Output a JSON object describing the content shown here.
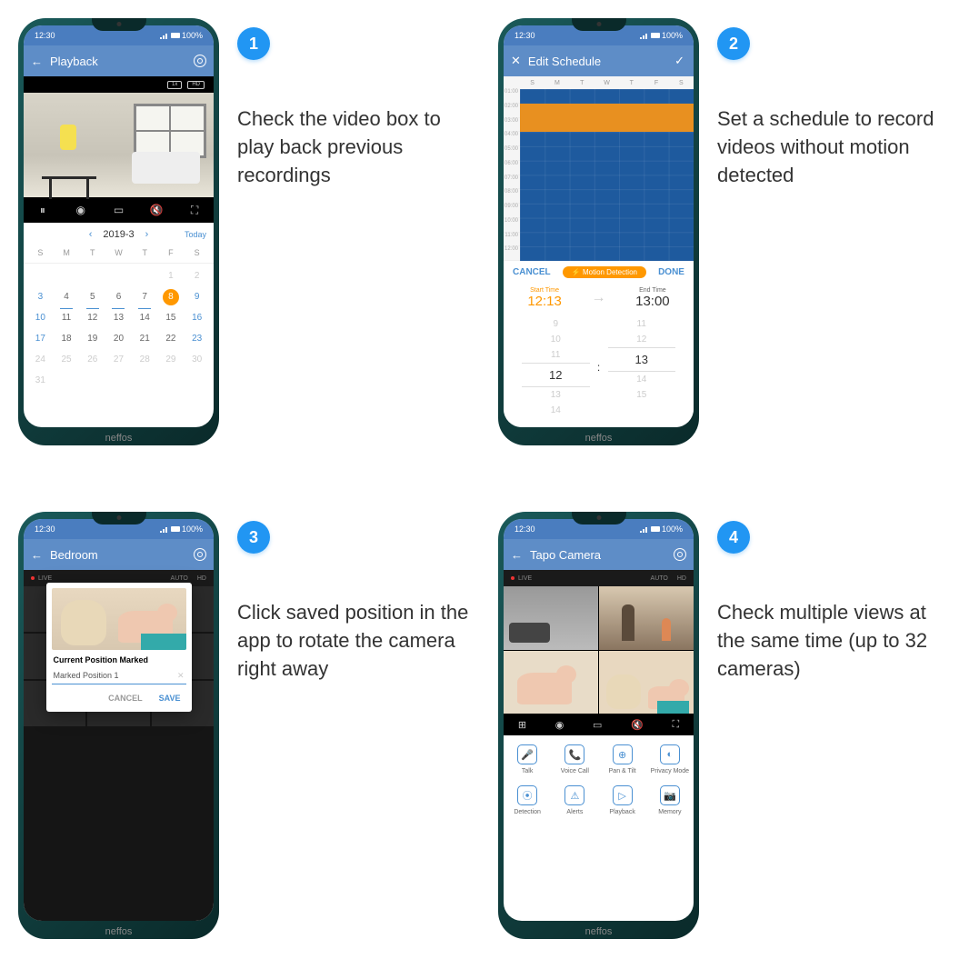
{
  "brand": "neffos",
  "statusbar": {
    "time": "12:30",
    "battery": "100%"
  },
  "captions": {
    "1": "Check the video box to play back previous recordings",
    "2": "Set a schedule to record videos without motion detected",
    "3": "Click saved position in the app to rotate the camera right away",
    "4": "Check multiple views at the same time (up to 32 cameras)"
  },
  "badges": {
    "1": "1",
    "2": "2",
    "3": "3",
    "4": "4"
  },
  "screen1": {
    "title": "Playback",
    "toolbar": {
      "speed": "1x",
      "hd": "HD"
    },
    "calendar": {
      "month": "2019-3",
      "today": "Today",
      "days": [
        "S",
        "M",
        "T",
        "W",
        "T",
        "F",
        "S"
      ],
      "selected": 8,
      "weeks": [
        [
          null,
          null,
          null,
          null,
          null,
          1,
          2
        ],
        [
          3,
          4,
          5,
          6,
          7,
          8,
          9
        ],
        [
          10,
          11,
          12,
          13,
          14,
          15,
          16
        ],
        [
          17,
          18,
          19,
          20,
          21,
          22,
          23
        ],
        [
          24,
          25,
          26,
          27,
          28,
          29,
          30
        ],
        [
          31,
          null,
          null,
          null,
          null,
          null,
          null
        ]
      ]
    }
  },
  "screen2": {
    "title": "Edit Schedule",
    "days": [
      "S",
      "M",
      "T",
      "W",
      "T",
      "F",
      "S"
    ],
    "hours": [
      "01:00",
      "02:00",
      "03:00",
      "04:00",
      "05:00",
      "06:00",
      "07:00",
      "08:00",
      "09:00",
      "10:00",
      "11:00",
      "12:00"
    ],
    "cancel": "CANCEL",
    "done": "DONE",
    "chip": "⚡ Motion Detection",
    "start": {
      "label": "Start Time",
      "value": "12:13"
    },
    "end": {
      "label": "End Time",
      "value": "13:00"
    },
    "picker_left": [
      "9",
      "10",
      "11",
      "12",
      "13",
      "14"
    ],
    "picker_right": [
      "11",
      "12",
      "13",
      "14",
      "15"
    ],
    "colon": ":"
  },
  "screen3": {
    "title": "Bedroom",
    "live": "LIVE",
    "auto": "AUTO",
    "hd": "HD",
    "modal": {
      "title": "Current Position Marked",
      "field": "Marked Position 1",
      "cancel": "CANCEL",
      "save": "SAVE"
    }
  },
  "screen4": {
    "title": "Tapo Camera",
    "live": "LIVE",
    "auto": "AUTO",
    "hd": "HD",
    "buttons": [
      {
        "label": "Talk",
        "icon": "🎤"
      },
      {
        "label": "Voice Call",
        "icon": "📞"
      },
      {
        "label": "Pan & Tilt",
        "icon": "⊕"
      },
      {
        "label": "Privacy Mode",
        "icon": "◐"
      },
      {
        "label": "Detection",
        "icon": "⦿"
      },
      {
        "label": "Alerts",
        "icon": "⚠"
      },
      {
        "label": "Playback",
        "icon": "▷"
      },
      {
        "label": "Memory",
        "icon": "📷"
      }
    ]
  }
}
